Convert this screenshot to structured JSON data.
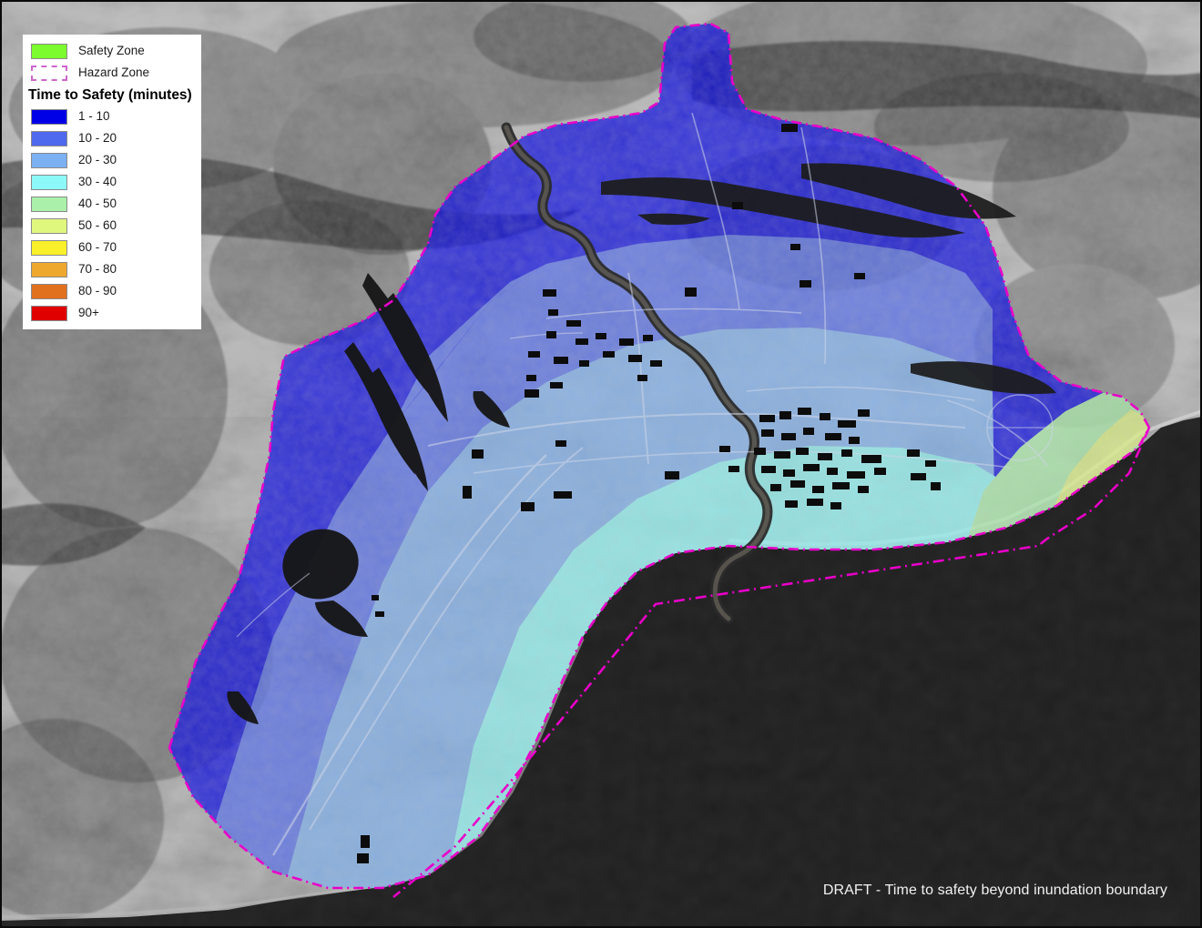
{
  "legend": {
    "categorical": [
      {
        "label": "Safety Zone",
        "color": "#7CFC2E",
        "style": "fill",
        "icon": "green-square-icon"
      },
      {
        "label": "Hazard Zone",
        "color": "#CC66CC",
        "style": "dashed-outline",
        "icon": "dashed-rectangle-icon"
      }
    ],
    "ramp_title": "Time to Safety (minutes)",
    "ramp": [
      {
        "label": "1 - 10",
        "color": "#0000E6"
      },
      {
        "label": "10 - 20",
        "color": "#4F69EE"
      },
      {
        "label": "20 - 30",
        "color": "#7BB0F2"
      },
      {
        "label": "30 - 40",
        "color": "#8DF8F8"
      },
      {
        "label": "40 - 50",
        "color": "#AAF0AA"
      },
      {
        "label": "50 - 60",
        "color": "#E0F77E"
      },
      {
        "label": "60 - 70",
        "color": "#FAF02A"
      },
      {
        "label": "70 - 80",
        "color": "#EFA82E"
      },
      {
        "label": "80 - 90",
        "color": "#E2711D"
      },
      {
        "label": "90+",
        "color": "#E00000"
      }
    ]
  },
  "caption": {
    "text": "DRAFT - Time to safety beyond inundation boundary"
  },
  "map": {
    "basemap_type": "grayscale-satellite-imagery",
    "ocean_color": "#1E1E1E",
    "hazard_boundary_color": "#E800C8",
    "hazard_boundary_style": "dash-dot",
    "overlay_opacity": 0.72
  },
  "chart_data": {
    "type": "map",
    "title": "Time to Safety (minutes)",
    "legend_position": "top-left",
    "zones": [
      {
        "name": "1 - 10",
        "color": "#0000E6",
        "role": "time-band"
      },
      {
        "name": "10 - 20",
        "color": "#4F69EE",
        "role": "time-band"
      },
      {
        "name": "20 - 30",
        "color": "#7BB0F2",
        "role": "time-band"
      },
      {
        "name": "30 - 40",
        "color": "#8DF8F8",
        "role": "time-band"
      },
      {
        "name": "40 - 50",
        "color": "#AAF0AA",
        "role": "time-band"
      },
      {
        "name": "50 - 60",
        "color": "#E0F77E",
        "role": "time-band"
      },
      {
        "name": "60 - 70",
        "color": "#FAF02A",
        "role": "time-band"
      },
      {
        "name": "70 - 80",
        "color": "#EFA82E",
        "role": "time-band"
      },
      {
        "name": "80 - 90",
        "color": "#E2711D",
        "role": "time-band"
      },
      {
        "name": "90+",
        "color": "#E00000",
        "role": "time-band"
      },
      {
        "name": "Safety Zone",
        "color": "#7CFC2E",
        "role": "category"
      },
      {
        "name": "Hazard Zone",
        "color": "#CC66CC",
        "role": "boundary"
      }
    ],
    "bands_present_in_view": [
      "1 - 10",
      "10 - 20",
      "20 - 30",
      "30 - 40",
      "40 - 50",
      "50 - 60"
    ],
    "annotations": [
      "DRAFT - Time to safety beyond inundation boundary"
    ]
  }
}
